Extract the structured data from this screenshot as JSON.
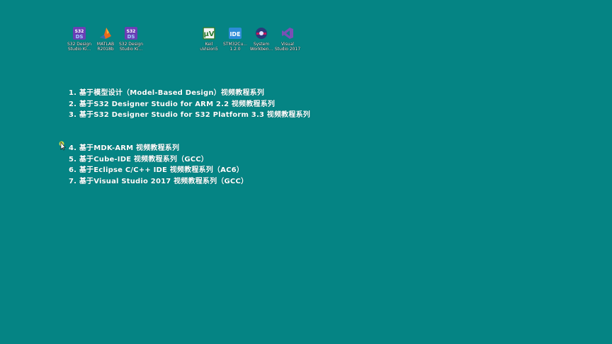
{
  "desktop": {
    "background_color": "#058484",
    "icons": [
      {
        "name": "s32ds-kinetis-icon",
        "label": "S32 Design\nStudio Ki...",
        "icon": "s32-logo",
        "color": "#6a3fb5"
      },
      {
        "name": "matlab-icon",
        "label": "MATLAB\nR2018b",
        "icon": "matlab-peak",
        "color": "#e86a1c"
      },
      {
        "name": "s32ds-kinetis-icon-2",
        "label": "S32 Design\nStudio Ki...",
        "icon": "s32-logo",
        "color": "#6a3fb5"
      },
      {
        "name": "keil-uvision5-icon",
        "label": "Keil\nuVision5",
        "icon": "keil-logo",
        "color": "#2e7d32"
      },
      {
        "name": "stm32cubeide-icon",
        "label": "STM32Cu...\n1.2.0",
        "icon": "ide-badge",
        "color": "#2d8cd8"
      },
      {
        "name": "system-workbench-icon",
        "label": "System\nWorkben...",
        "icon": "workbench-logo",
        "color": "#2b3a7a"
      },
      {
        "name": "visual-studio-2017-icon",
        "label": "Visual\nStudio 2017",
        "icon": "vs-logo",
        "color": "#7b4fb5"
      }
    ]
  },
  "list_group_1": [
    "1. 基于模型设计（Model-Based Design）视频教程系列",
    "2. 基于S32 Designer Studio for ARM 2.2 视频教程系列",
    "3. 基于S32 Designer Studio for S32 Platform 3.3 视频教程系列"
  ],
  "list_group_2": [
    "4. 基于MDK-ARM 视频教程系列",
    "5. 基于Cube-IDE 视频教程系列（GCC）",
    "6. 基于Eclipse C/C++ IDE 视频教程系列（AC6）",
    "7. 基于Visual Studio 2017 视频教程系列（GCC）"
  ]
}
